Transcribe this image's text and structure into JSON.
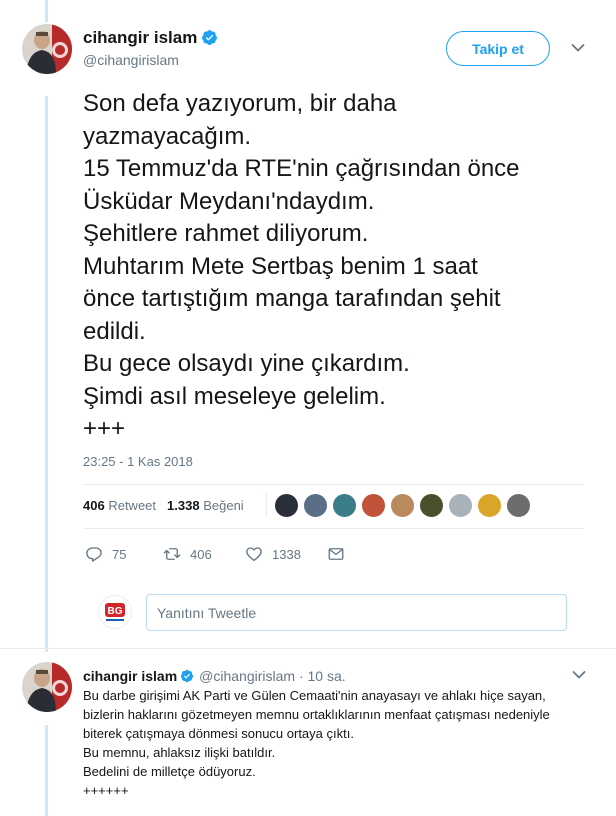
{
  "tweet": {
    "author_name": "cihangir islam",
    "author_handle": "@cihangirislam",
    "follow_label": "Takip et",
    "text_lines": [
      "Son defa yazıyorum, bir daha",
      "yazmayacağım.",
      "15 Temmuz'da RTE'nin çağrısından önce",
      "Üsküdar Meydanı'ndaydım.",
      "Şehitlere rahmet diliyorum.",
      "Muhtarım Mete Sertbaş benim 1 saat",
      "önce tartıştığım manga tarafından şehit",
      "edildi.",
      "Bu gece olsaydı yine çıkardım.",
      "Şimdi asıl meseleye gelelim.",
      "+++"
    ],
    "timestamp": "23:25 - 1 Kas 2018",
    "retweet_count": "406",
    "retweet_label": "Retweet",
    "like_count": "1.338",
    "like_label": "Beğeni",
    "likers": [
      {
        "name": "liker-avatar-1",
        "color": "#2b2f3a"
      },
      {
        "name": "liker-avatar-2",
        "color": "#5a6f86"
      },
      {
        "name": "liker-avatar-3",
        "color": "#3c7d8c"
      },
      {
        "name": "liker-avatar-4",
        "color": "#c0533a"
      },
      {
        "name": "liker-avatar-5",
        "color": "#b88a5e"
      },
      {
        "name": "liker-avatar-6",
        "color": "#4b4f2e"
      },
      {
        "name": "liker-avatar-7",
        "color": "#a9b1ba"
      },
      {
        "name": "liker-avatar-8",
        "color": "#d9a62a"
      },
      {
        "name": "liker-avatar-9",
        "color": "#6d6d6d"
      }
    ],
    "actions": {
      "reply_count": "75",
      "retweet_count": "406",
      "like_count": "1338"
    }
  },
  "reply_composer": {
    "placeholder": "Yanıtını Tweetle",
    "avatar_text": "BG"
  },
  "reply_tweet": {
    "author_name": "cihangir islam",
    "author_handle": "@cihangirislam",
    "time_ago": "· 10 sa.",
    "text_lines": [
      "Bu darbe girişimi AK Parti ve Gülen Cemaati'nin anayasayı ve ahlakı hiçe sayan,",
      "bizlerin haklarını gözetmeyen memnu ortaklıklarının menfaat çatışması nedeniyle",
      "biterek çatışmaya dönmesi sonucu ortaya çıktı.",
      "Bu memnu, ahlaksız ilişki batıldır.",
      "Bedelini de milletçe ödüyoruz.",
      "++++++"
    ]
  },
  "colors": {
    "accent": "#1da1f2",
    "thread_line": "#cfe8f9",
    "muted": "#657786"
  }
}
